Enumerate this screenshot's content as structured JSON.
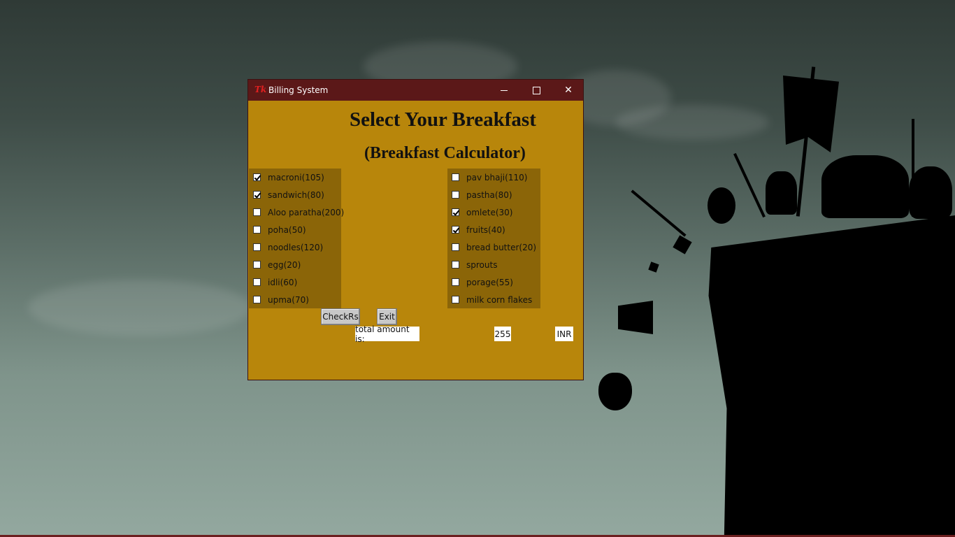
{
  "window": {
    "title": "Billing System",
    "app_icon": "tk-icon",
    "controls": [
      "minimize-icon",
      "maximize-icon",
      "close-icon"
    ]
  },
  "heading": {
    "title": "Select Your Breakfast",
    "subtitle": "(Breakfast Calculator)"
  },
  "menu": {
    "left": [
      {
        "label": "macroni(105)",
        "checked": true
      },
      {
        "label": "sandwich(80)",
        "checked": true
      },
      {
        "label": "Aloo paratha(200)",
        "checked": false
      },
      {
        "label": "poha(50)",
        "checked": false
      },
      {
        "label": "noodles(120)",
        "checked": false
      },
      {
        "label": "egg(20)",
        "checked": false
      },
      {
        "label": "idli(60)",
        "checked": false
      },
      {
        "label": "upma(70)",
        "checked": false
      }
    ],
    "right": [
      {
        "label": "pav bhaji(110)",
        "checked": false
      },
      {
        "label": "pastha(80)",
        "checked": false
      },
      {
        "label": "omlete(30)",
        "checked": true
      },
      {
        "label": "fruits(40)",
        "checked": true
      },
      {
        "label": "bread butter(20)",
        "checked": false
      },
      {
        "label": "sprouts",
        "checked": false
      },
      {
        "label": "porage(55)",
        "checked": false
      },
      {
        "label": "milk corn flakes",
        "checked": false
      }
    ]
  },
  "buttons": {
    "check": "CheckRs",
    "exit": "Exit"
  },
  "total": {
    "label": "total amount is:",
    "amount": "255",
    "currency": "INR"
  },
  "colors": {
    "window_bg": "#b8860b",
    "column_bg": "#8b6508",
    "titlebar": "#5b1818"
  }
}
